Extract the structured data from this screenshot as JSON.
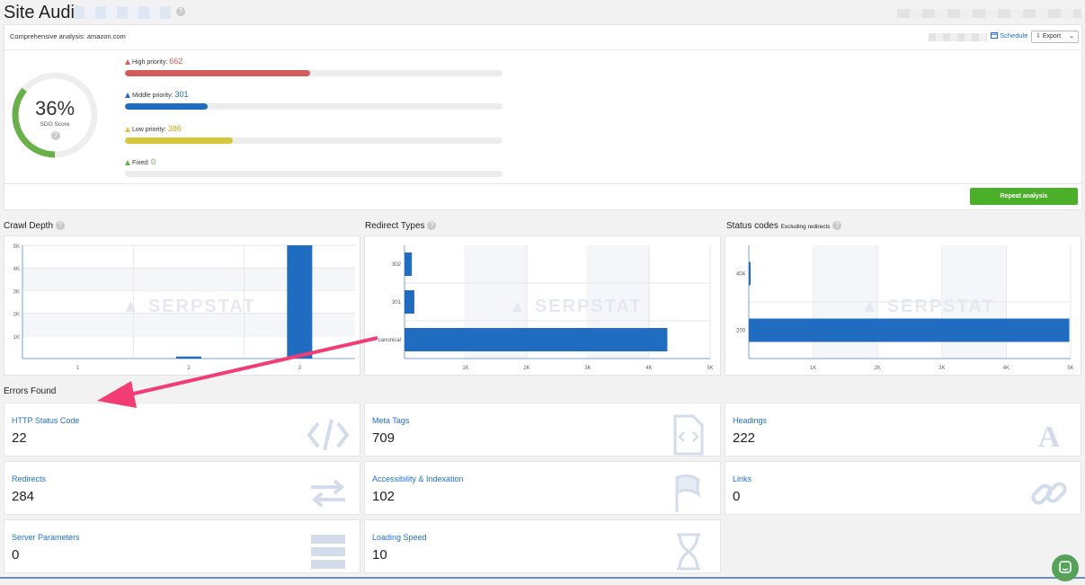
{
  "header": {
    "title": "Site Audit"
  },
  "summary": {
    "analysis_label": "Comprehensive analysis: amazon.com",
    "schedule_label": "Schedule",
    "export_label": "Export",
    "score": "36%",
    "score_value": 36,
    "score_label": "SDO Score",
    "priorities": [
      {
        "label": "High priority:",
        "count": "662",
        "fraction": 0.49,
        "color": "#d25c5c"
      },
      {
        "label": "Middle priority:",
        "count": "301",
        "fraction": 0.22,
        "color": "#1f6cc1"
      },
      {
        "label": "Low priority:",
        "count": "386",
        "fraction": 0.285,
        "color": "#d6c63a"
      },
      {
        "label": "Fixed:",
        "count": "0",
        "fraction": 0,
        "color": "#67b04a"
      }
    ],
    "repeat_label": "Repeat analysis"
  },
  "charts": {
    "crawl_title": "Crawl Depth",
    "redirect_title": "Redirect Types",
    "status_title": "Status codes",
    "status_subtitle": "Excluding redirects",
    "watermark": "SERPSTAT"
  },
  "chart_data": [
    {
      "type": "bar",
      "title": "Crawl Depth",
      "categories": [
        "1",
        "2",
        "3"
      ],
      "values": [
        0,
        90,
        5000
      ],
      "ylim": [
        0,
        5000
      ],
      "yticks": [
        "1K",
        "2K",
        "3K",
        "4K",
        "5K"
      ],
      "grid": true
    },
    {
      "type": "bar",
      "orientation": "horizontal",
      "title": "Redirect Types",
      "categories": [
        "302",
        "301",
        "canonical"
      ],
      "values": [
        120,
        160,
        4300
      ],
      "xlim": [
        0,
        5000
      ],
      "xticks": [
        "1K",
        "2K",
        "3K",
        "4K",
        "5K"
      ],
      "grid": true
    },
    {
      "type": "bar",
      "orientation": "horizontal",
      "title": "Status codes",
      "subtitle": "Excluding redirects",
      "categories": [
        "404",
        "200"
      ],
      "values": [
        20,
        4980
      ],
      "xlim": [
        0,
        5000
      ],
      "xticks": [
        "1K",
        "2K",
        "3K",
        "4K",
        "5K"
      ],
      "grid": true
    }
  ],
  "errors": {
    "title": "Errors Found",
    "items": [
      {
        "label": "HTTP Status Code",
        "value": "22",
        "icon": "code-icon"
      },
      {
        "label": "Meta Tags",
        "value": "709",
        "icon": "file-code-icon"
      },
      {
        "label": "Headings",
        "value": "222",
        "icon": "heading-icon"
      },
      {
        "label": "Redirects",
        "value": "284",
        "icon": "arrows-icon"
      },
      {
        "label": "Accessibility & Indexation",
        "value": "102",
        "icon": "flag-icon"
      },
      {
        "label": "Links",
        "value": "0",
        "icon": "link-icon"
      },
      {
        "label": "Server Parameters",
        "value": "0",
        "icon": "server-icon"
      },
      {
        "label": "Loading Speed",
        "value": "10",
        "icon": "hourglass-icon"
      }
    ]
  }
}
